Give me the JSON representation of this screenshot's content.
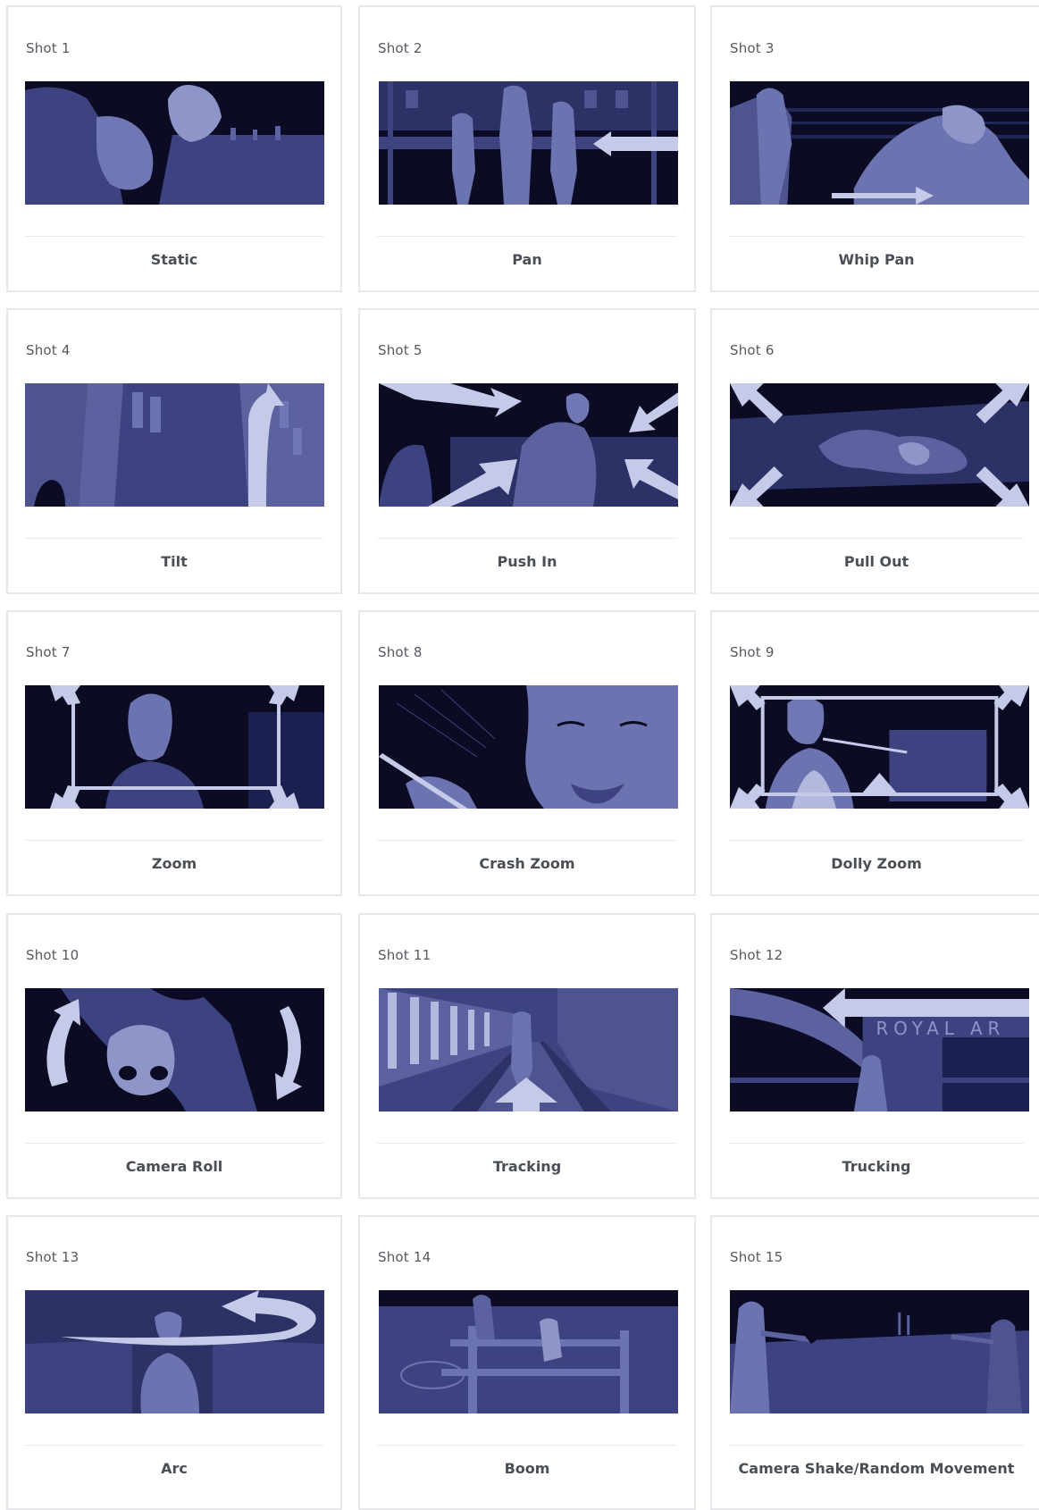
{
  "colors": {
    "thumb_dark": "#0b0b24",
    "thumb_mid": "#3d4380",
    "thumb_light": "#5b629f",
    "thumb_pale": "#8e95c8",
    "arrow": "#c5cae8",
    "card_border": "#e6e8ec",
    "label_text": "#4a4f55",
    "shot_text": "#555a60"
  },
  "shots": [
    {
      "shot": "Shot 1",
      "label": "Static",
      "icon": "static-thumbnail"
    },
    {
      "shot": "Shot 2",
      "label": "Pan",
      "icon": "pan-thumbnail"
    },
    {
      "shot": "Shot 3",
      "label": "Whip Pan",
      "icon": "whip-pan-thumbnail"
    },
    {
      "shot": "Shot 4",
      "label": "Tilt",
      "icon": "tilt-thumbnail"
    },
    {
      "shot": "Shot 5",
      "label": "Push In",
      "icon": "push-in-thumbnail"
    },
    {
      "shot": "Shot 6",
      "label": "Pull Out",
      "icon": "pull-out-thumbnail"
    },
    {
      "shot": "Shot 7",
      "label": "Zoom",
      "icon": "zoom-thumbnail"
    },
    {
      "shot": "Shot 8",
      "label": "Crash Zoom",
      "icon": "crash-zoom-thumbnail"
    },
    {
      "shot": "Shot 9",
      "label": "Dolly Zoom",
      "icon": "dolly-zoom-thumbnail"
    },
    {
      "shot": "Shot 10",
      "label": "Camera Roll",
      "icon": "camera-roll-thumbnail"
    },
    {
      "shot": "Shot 11",
      "label": "Tracking",
      "icon": "tracking-thumbnail"
    },
    {
      "shot": "Shot 12",
      "label": "Trucking",
      "icon": "trucking-thumbnail",
      "sign_text": "ROYAL AR"
    },
    {
      "shot": "Shot 13",
      "label": "Arc",
      "icon": "arc-thumbnail"
    },
    {
      "shot": "Shot 14",
      "label": "Boom",
      "icon": "boom-thumbnail"
    },
    {
      "shot": "Shot 15",
      "label": "Camera Shake/Random Movement",
      "icon": "camera-shake-thumbnail"
    }
  ]
}
